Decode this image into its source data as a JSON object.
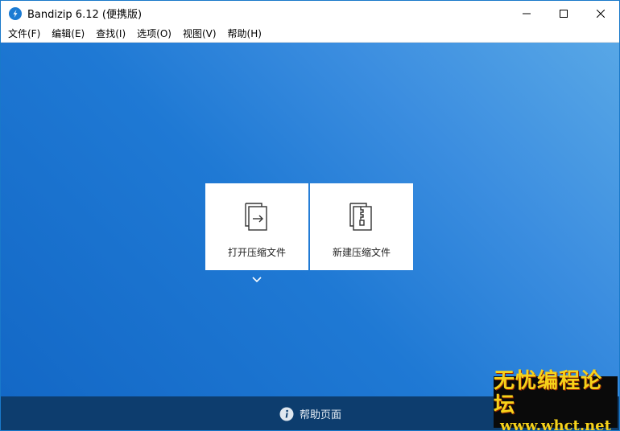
{
  "window": {
    "title": "Bandizip 6.12 (便携版)"
  },
  "menu": [
    "文件(F)",
    "编辑(E)",
    "查找(I)",
    "选项(O)",
    "视图(V)",
    "帮助(H)"
  ],
  "cards": {
    "open_label": "打开压缩文件",
    "new_label": "新建压缩文件"
  },
  "footer": {
    "help_label": "帮助页面"
  },
  "watermark": {
    "line1": "无忧编程论坛",
    "line2": "www.whct.net"
  },
  "colors": {
    "gradient_light": "#58a7e6",
    "gradient_dark": "#1368c6",
    "footer": "#0d3d6e",
    "watermark_text": "#f6d21a"
  }
}
